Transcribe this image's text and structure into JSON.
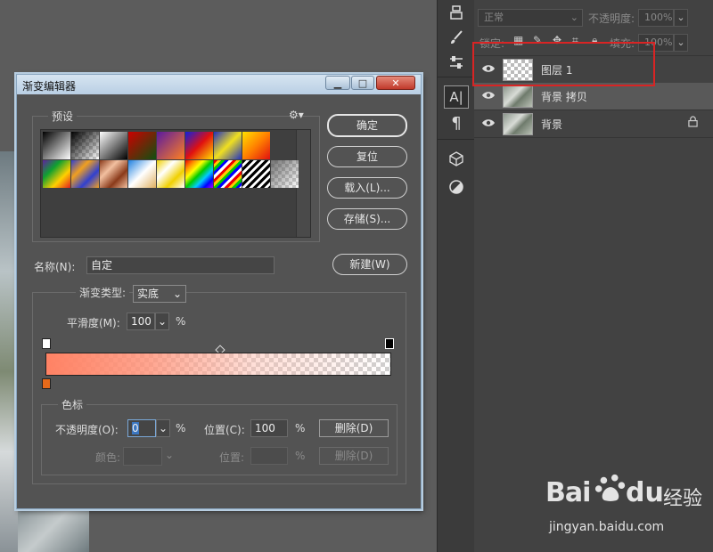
{
  "layers_panel": {
    "blend_mode": "正常",
    "opacity_label": "不透明度:",
    "opacity_value": "100%",
    "lock_label": "锁定:",
    "fill_label": "填充:",
    "fill_value": "100%",
    "layers": [
      {
        "name": "图层 1",
        "thumb": "transparent",
        "selected": false,
        "locked": false
      },
      {
        "name": "背景 拷贝",
        "thumb": "photo",
        "selected": true,
        "locked": false
      },
      {
        "name": "背景",
        "thumb": "photo",
        "selected": false,
        "locked": true
      }
    ],
    "highlight_color": "#d92424"
  },
  "toolstrip": {
    "type_tool_label": "A|",
    "paragraph_label": "¶"
  },
  "dialog": {
    "title": "渐变编辑器",
    "presets_label": "预设",
    "buttons": {
      "ok": "确定",
      "reset": "复位",
      "load": "载入(L)...",
      "save": "存储(S)...",
      "new": "新建(W)"
    },
    "name_label": "名称(N):",
    "name_value": "自定",
    "gradient_type_label": "渐变类型:",
    "gradient_type_value": "实底",
    "smoothness_label": "平滑度(M):",
    "smoothness_value": "100",
    "percent": "%",
    "stops_label": "色标",
    "opacity_label": "不透明度(O):",
    "opacity_value": "0",
    "location_label": "位置(C):",
    "location_value": "100",
    "delete_label": "删除(D)",
    "color_label": "颜色:",
    "color_location_label": "位置:",
    "color_delete_label": "删除(D)",
    "gradient_colors": {
      "start": "#ff8264",
      "end": "transparent",
      "color_stop": "#e86a1a"
    }
  },
  "watermark": {
    "brand_a": "Bai",
    "brand_b": "du",
    "brand_cn": "经验",
    "url": "jingyan.baidu.com"
  }
}
